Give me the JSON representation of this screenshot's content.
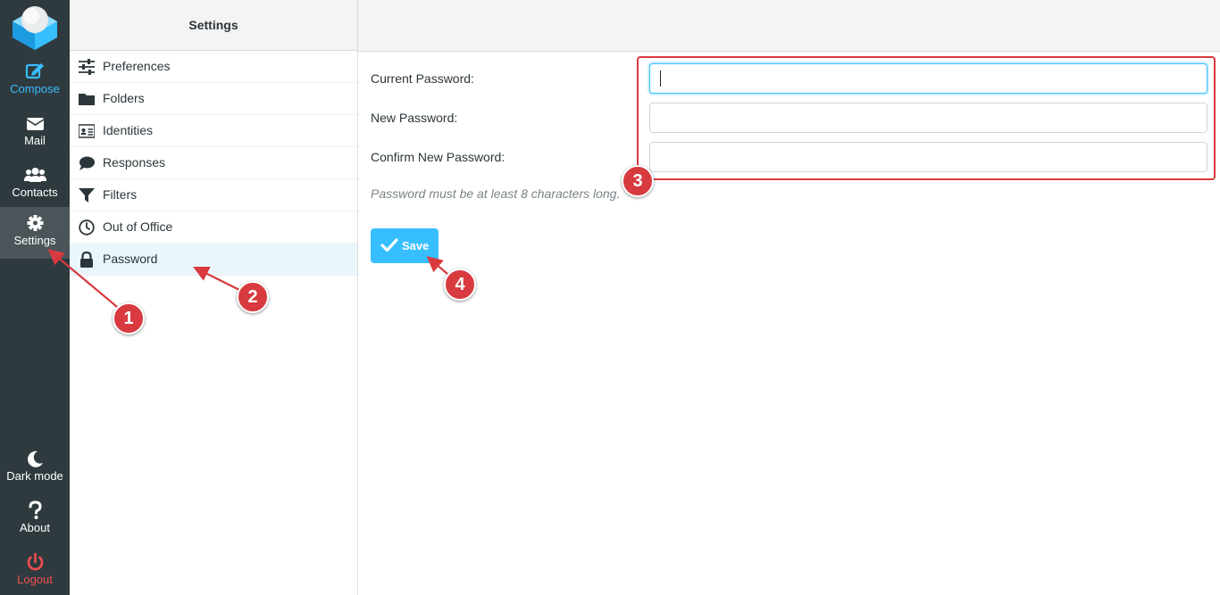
{
  "nav": {
    "compose": "Compose",
    "mail": "Mail",
    "contacts": "Contacts",
    "settings": "Settings",
    "dark_mode": "Dark mode",
    "about": "About",
    "logout": "Logout"
  },
  "settings_panel": {
    "title": "Settings",
    "items": [
      {
        "label": "Preferences",
        "icon": "sliders-icon"
      },
      {
        "label": "Folders",
        "icon": "folder-icon"
      },
      {
        "label": "Identities",
        "icon": "id-card-icon"
      },
      {
        "label": "Responses",
        "icon": "comment-icon"
      },
      {
        "label": "Filters",
        "icon": "filter-icon"
      },
      {
        "label": "Out of Office",
        "icon": "clock-icon"
      },
      {
        "label": "Password",
        "icon": "lock-icon",
        "selected": true
      }
    ]
  },
  "form": {
    "current_password_label": "Current Password:",
    "current_password_value": "",
    "new_password_label": "New Password:",
    "new_password_value": "",
    "confirm_password_label": "Confirm New Password:",
    "confirm_password_value": "",
    "hint": "Password must be at least 8 characters long.",
    "save_label": "Save"
  },
  "annotations": {
    "badge_1": "1",
    "badge_2": "2",
    "badge_3": "3",
    "badge_4": "4"
  },
  "colors": {
    "nav_bg": "#2f3a3f",
    "accent": "#37beff",
    "annotation": "#d83a3f",
    "logout": "#f04e4e"
  }
}
